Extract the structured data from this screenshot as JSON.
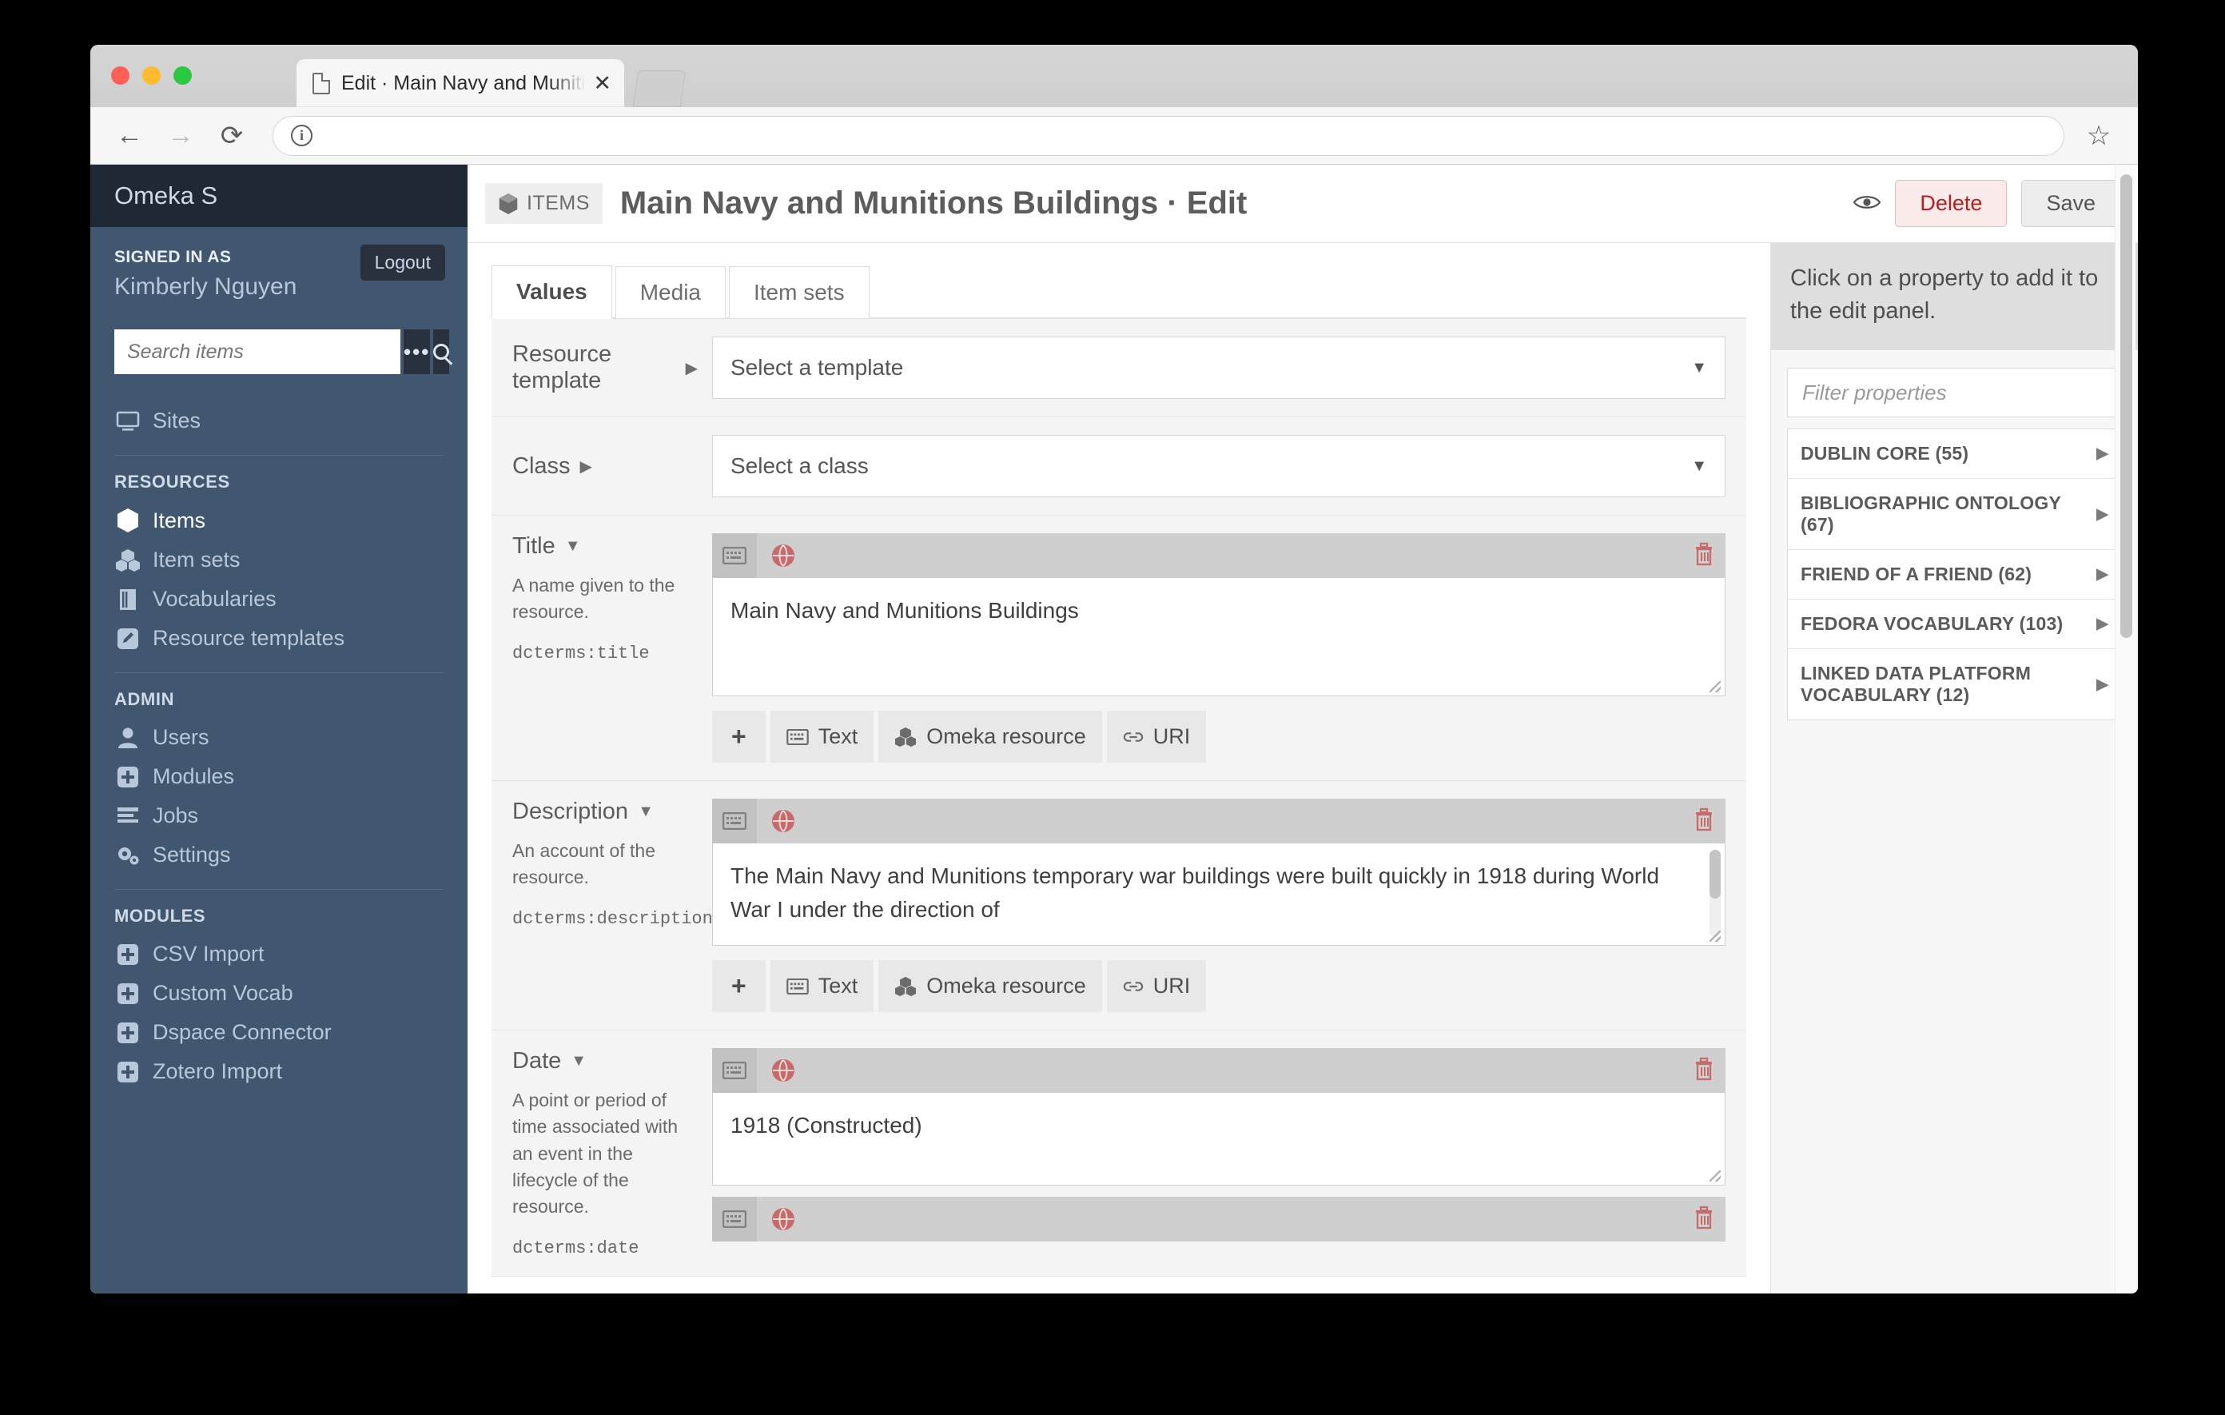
{
  "browser": {
    "tab_title": "Edit · Main Navy and Munitions",
    "tab_close": "✕",
    "url_value": "",
    "back_icon": "←",
    "forward_icon": "→",
    "reload_icon": "⟳",
    "info_icon": "i",
    "star_icon": "☆"
  },
  "sidebar": {
    "brand": "Omeka S",
    "signed_in_label": "SIGNED IN AS",
    "username": "Kimberly Nguyen",
    "logout_label": "Logout",
    "search_placeholder": "Search items",
    "search_value": "",
    "advanced_label": "•••",
    "top_items": [
      {
        "label": "Sites",
        "icon": "monitor-icon",
        "active": false
      }
    ],
    "sections": [
      {
        "heading": "RESOURCES",
        "items": [
          {
            "label": "Items",
            "icon": "cube-icon",
            "active": true
          },
          {
            "label": "Item sets",
            "icon": "cubes-icon",
            "active": false
          },
          {
            "label": "Vocabularies",
            "icon": "book-icon",
            "active": false
          },
          {
            "label": "Resource templates",
            "icon": "pencil-square-icon",
            "active": false
          }
        ]
      },
      {
        "heading": "ADMIN",
        "items": [
          {
            "label": "Users",
            "icon": "user-icon",
            "active": false
          },
          {
            "label": "Modules",
            "icon": "plus-square-icon",
            "active": false
          },
          {
            "label": "Jobs",
            "icon": "list-icon",
            "active": false
          },
          {
            "label": "Settings",
            "icon": "gears-icon",
            "active": false
          }
        ]
      },
      {
        "heading": "MODULES",
        "items": [
          {
            "label": "CSV Import",
            "icon": "plus-square-icon",
            "active": false
          },
          {
            "label": "Custom Vocab",
            "icon": "plus-square-icon",
            "active": false
          },
          {
            "label": "Dspace Connector",
            "icon": "plus-square-icon",
            "active": false
          },
          {
            "label": "Zotero Import",
            "icon": "plus-square-icon",
            "active": false
          }
        ]
      }
    ]
  },
  "header": {
    "breadcrumb_label": "ITEMS",
    "title": "Main Navy and Munitions Buildings · Edit",
    "preview_icon": "eye-icon",
    "delete_label": "Delete",
    "save_label": "Save"
  },
  "tabs": [
    {
      "label": "Values",
      "active": true
    },
    {
      "label": "Media",
      "active": false
    },
    {
      "label": "Item sets",
      "active": false
    }
  ],
  "selects": [
    {
      "label": "Resource template",
      "value": "Select a template"
    },
    {
      "label": "Class",
      "value": "Select a class"
    }
  ],
  "properties": [
    {
      "label": "Title",
      "comment": "A name given to the resource.",
      "term": "dcterms:title",
      "value": "Main Navy and Munitions Buildings",
      "has_scrollbar": false
    },
    {
      "label": "Description",
      "comment": "An account of the resource.",
      "term": "dcterms:description",
      "value": "The Main Navy and Munitions temporary war buildings were built quickly in 1918 during World War I under the direction of",
      "has_scrollbar": true
    },
    {
      "label": "Date",
      "comment": "A point or period of time associated with an event in the lifecycle of the resource.",
      "term": "dcterms:date",
      "value": "1918 (Constructed)",
      "has_scrollbar": false
    }
  ],
  "value_actions": {
    "add_label": "+",
    "text_label": "Text",
    "resource_label": "Omeka resource",
    "uri_label": "URI"
  },
  "property_panel": {
    "note": "Click on a property to add it to the edit panel.",
    "filter_placeholder": "Filter properties",
    "filter_value": "",
    "vocabularies": [
      {
        "label": "DUBLIN CORE (55)"
      },
      {
        "label": "BIBLIOGRAPHIC ONTOLOGY (67)"
      },
      {
        "label": "FRIEND OF A FRIEND (62)"
      },
      {
        "label": "FEDORA VOCABULARY (103)"
      },
      {
        "label": "LINKED DATA PLATFORM VOCABULARY (12)"
      }
    ]
  },
  "colors": {
    "sidebar_bg": "#41566f",
    "brand_bg": "#1f2935",
    "delete_red": "#b32020",
    "lang_red": "#c96a6a"
  }
}
